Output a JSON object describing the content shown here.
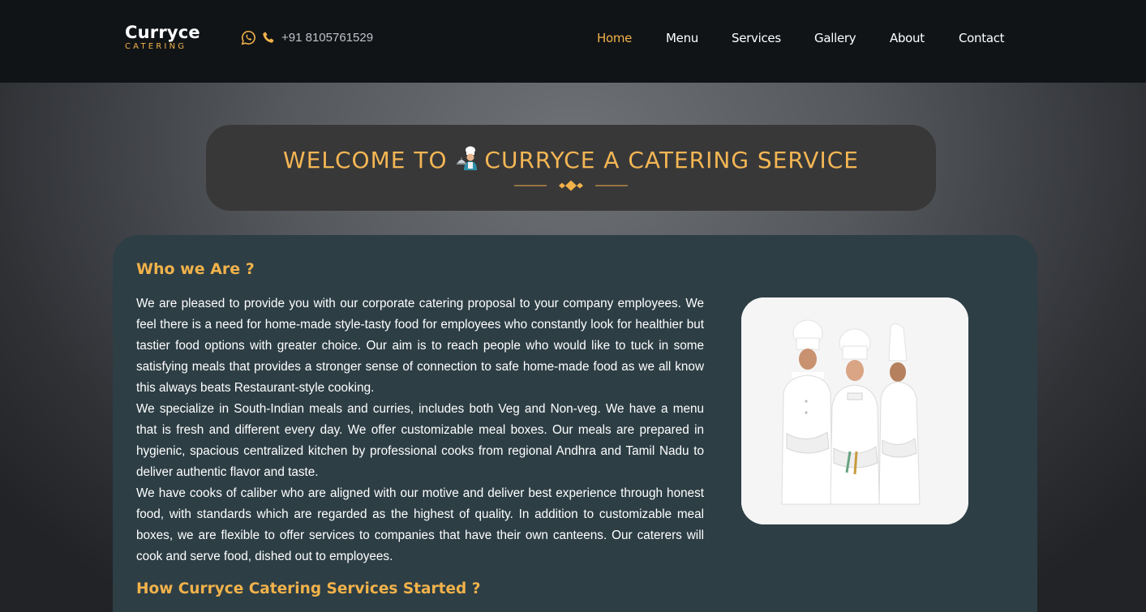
{
  "header": {
    "brand_name": "Curryce",
    "brand_sub": "CATERING",
    "phone": "+91 8105761529",
    "icons": [
      "whatsapp-icon",
      "phone-icon"
    ],
    "nav": [
      "Home",
      "Menu",
      "Services",
      "Gallery",
      "About",
      "Contact"
    ],
    "active_nav": "Home"
  },
  "welcome": {
    "title_before": "WELCOME TO",
    "title_after": "CURRYCE A CATERING SERVICE",
    "icon": "chef-icon"
  },
  "about": {
    "heading": "Who we Are ?",
    "paragraphs": [
      "We are pleased to provide you with our corporate catering proposal to your company employees. We feel there is a need for home-made style-tasty food for employees who constantly look for healthier but tastier food options with greater choice. Our aim is to reach people who would like to tuck in some satisfying meals that provides a stronger sense of connection to safe home-made food as we all know this always beats Restaurant-style cooking.",
      "We specialize in South-Indian meals and curries, includes both Veg and Non-veg. We have a menu that is fresh and different every day. We offer customizable meal boxes. Our meals are prepared in hygienic, spacious centralized kitchen by professional cooks from regional Andhra and Tamil Nadu to deliver authentic flavor and taste.",
      "We have cooks of caliber who are aligned with our motive and deliver best experience through honest food, with standards which are regarded as the highest of quality. In addition to customizable meal boxes, we are flexible to offer services to companies that have their own canteens. Our caterers will cook and serve food, dished out to employees."
    ],
    "image_subject": "three-chefs-photo",
    "next_heading": "How Curryce Catering Services Started ?"
  },
  "colors": {
    "accent": "#f1b24a",
    "topbar": "#111417",
    "card": "#2d3e45",
    "welcome_box": "#383838"
  }
}
